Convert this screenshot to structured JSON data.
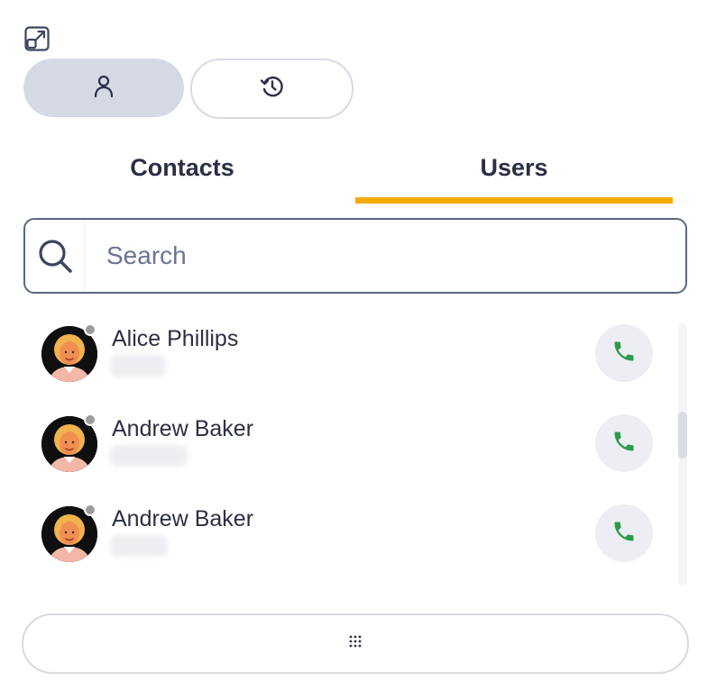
{
  "header": {
    "popout_icon": "external-window-icon"
  },
  "mode_toggle": {
    "users_icon": "person-icon",
    "history_icon": "history-icon"
  },
  "tabs": [
    {
      "label": "Contacts",
      "active": false
    },
    {
      "label": "Users",
      "active": true
    }
  ],
  "accent_color": "#f5ab00",
  "search": {
    "placeholder": "Search",
    "value": ""
  },
  "users": [
    {
      "name": "Alice Phillips",
      "status": "offline"
    },
    {
      "name": "Andrew Baker",
      "status": "offline"
    },
    {
      "name": "Andrew Baker",
      "status": "offline"
    }
  ],
  "call_icon": "phone-icon",
  "call_icon_color": "#2e9a4a",
  "footer": {
    "dialpad_icon": "dialpad-icon"
  }
}
